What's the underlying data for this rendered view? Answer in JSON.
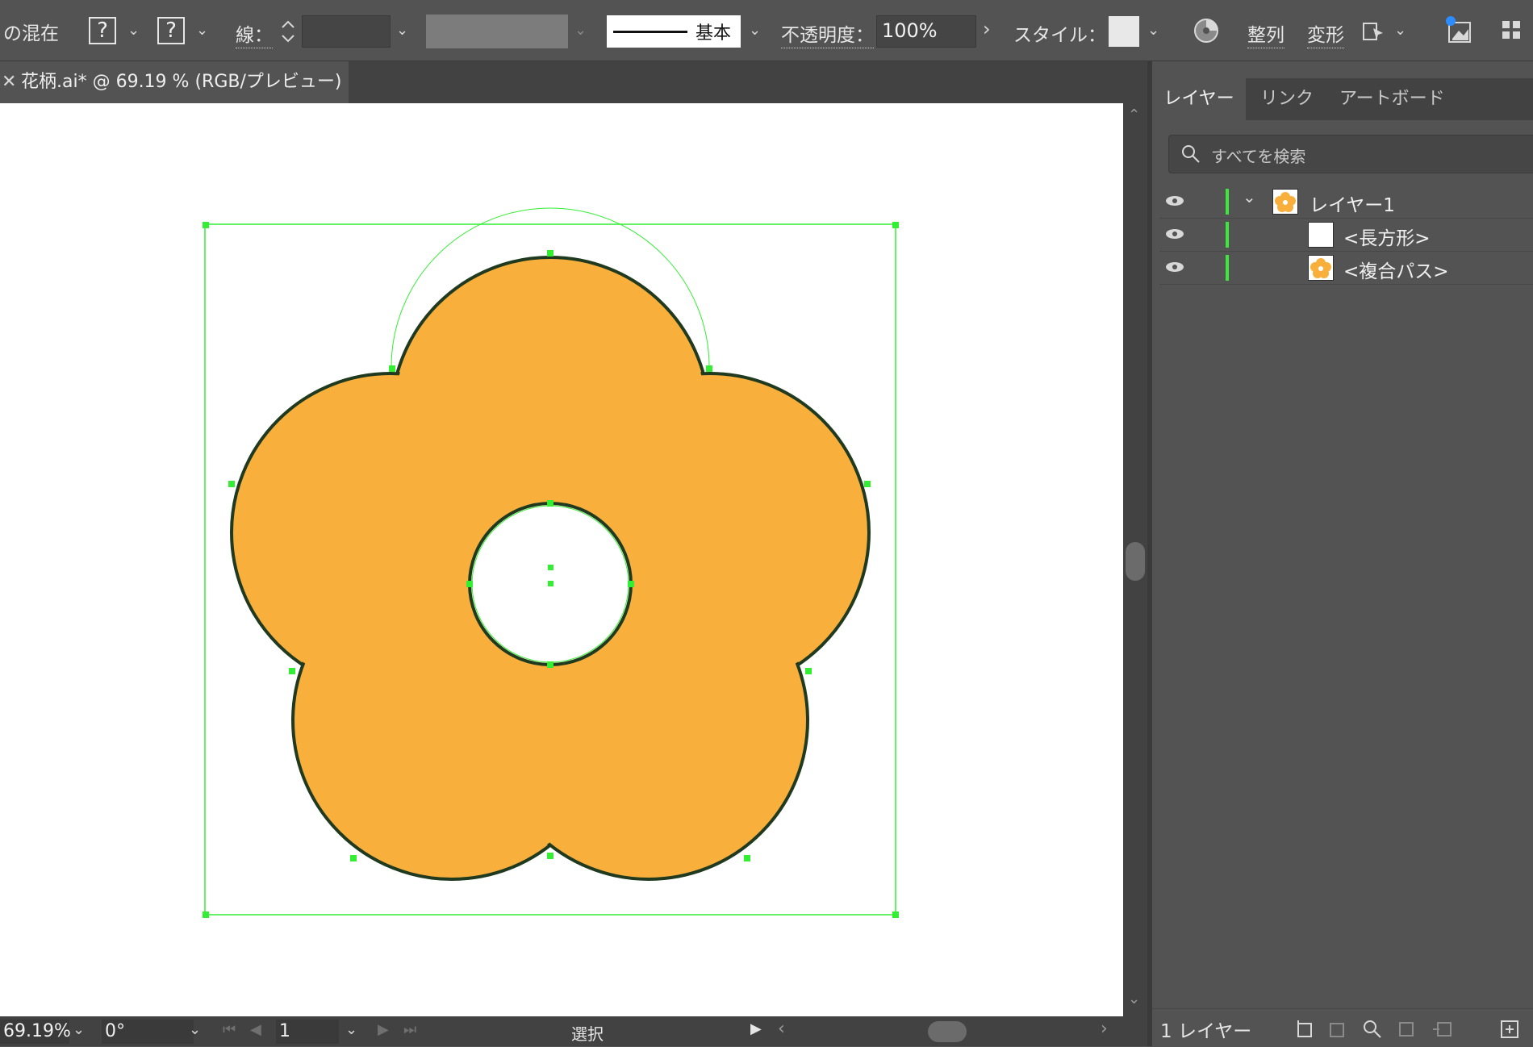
{
  "controlbar": {
    "mix_label": "の混在",
    "fill_placeholder": "?",
    "stroke_placeholder": "?",
    "stroke_label": "線：",
    "profile_label": "基本",
    "opacity_label": "不透明度：",
    "opacity_value": "100%",
    "style_label": "スタイル：",
    "align_label": "整列",
    "transform_label": "変形"
  },
  "document": {
    "tab_title": "花柄.ai* @ 69.19 % (RGB/プレビュー)",
    "close_icon": "close-icon"
  },
  "artwork": {
    "fill_color": "#F9AF3C",
    "stroke_color": "#1f3a1f",
    "selection_color": "#33ee33",
    "shape": "five-petal flower with center hole"
  },
  "layers_panel": {
    "tabs": [
      "レイヤー",
      "リンク",
      "アートボード"
    ],
    "active_tab": "レイヤー",
    "search_placeholder": "すべてを検索",
    "rows": [
      {
        "label": "レイヤー1",
        "expanded": true,
        "visible": true,
        "thumb": "flower"
      },
      {
        "label": "<長方形>",
        "visible": true,
        "thumb": "white-rect"
      },
      {
        "label": "<複合パス>",
        "visible": true,
        "thumb": "flower"
      }
    ],
    "footer_count": "1 レイヤー"
  },
  "statusbar": {
    "zoom": "69.19%",
    "rotation": "0°",
    "artboard_number": "1",
    "tool_name": "選択"
  }
}
